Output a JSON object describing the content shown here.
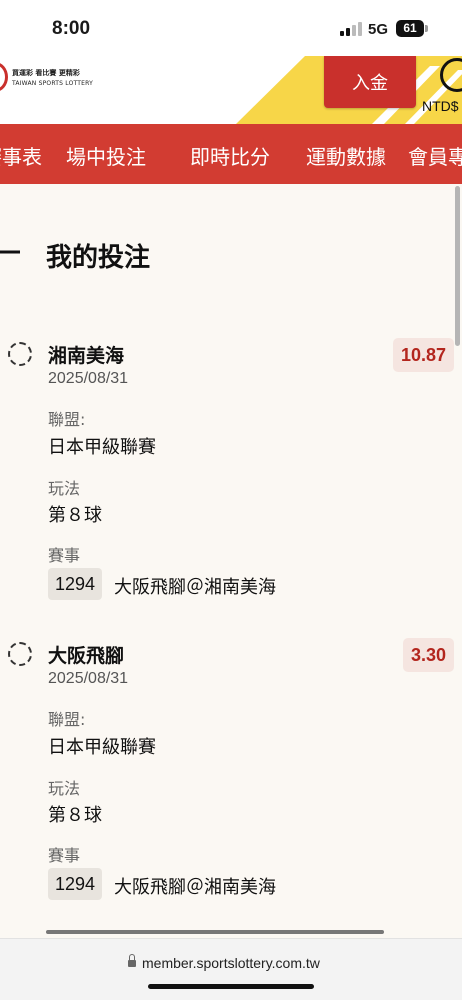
{
  "status_bar": {
    "time": "8:00",
    "network": "5G",
    "battery": "61"
  },
  "header": {
    "logo_line1": "買運彩 看比賽 更精彩",
    "logo_line2": "TAIWAN SPORTS LOTTERY",
    "deposit_label": "入金",
    "currency": "NTD$"
  },
  "nav": {
    "items": [
      "賽事表",
      "場中投注",
      "即時比分",
      "運動數據",
      "會員專區"
    ]
  },
  "page": {
    "title": "我的投注"
  },
  "bets": [
    {
      "team": "湘南美海",
      "date": "2025/08/31",
      "odds": "10.87",
      "league_label": "聯盟:",
      "league": "日本甲級聯賽",
      "play_label": "玩法",
      "play": "第８球",
      "event_label": "賽事",
      "match_id": "1294",
      "match_name": "大阪飛腳＠湘南美海"
    },
    {
      "team": "大阪飛腳",
      "date": "2025/08/31",
      "odds": "3.30",
      "league_label": "聯盟:",
      "league": "日本甲級聯賽",
      "play_label": "玩法",
      "play": "第８球",
      "event_label": "賽事",
      "match_id": "1294",
      "match_name": "大阪飛腳＠湘南美海"
    }
  ],
  "browser": {
    "url": "member.sportslottery.com.tw"
  },
  "colors": {
    "brand_red": "#d23c32",
    "odds_red": "#b3261e",
    "accent_yellow": "#f7d648"
  }
}
